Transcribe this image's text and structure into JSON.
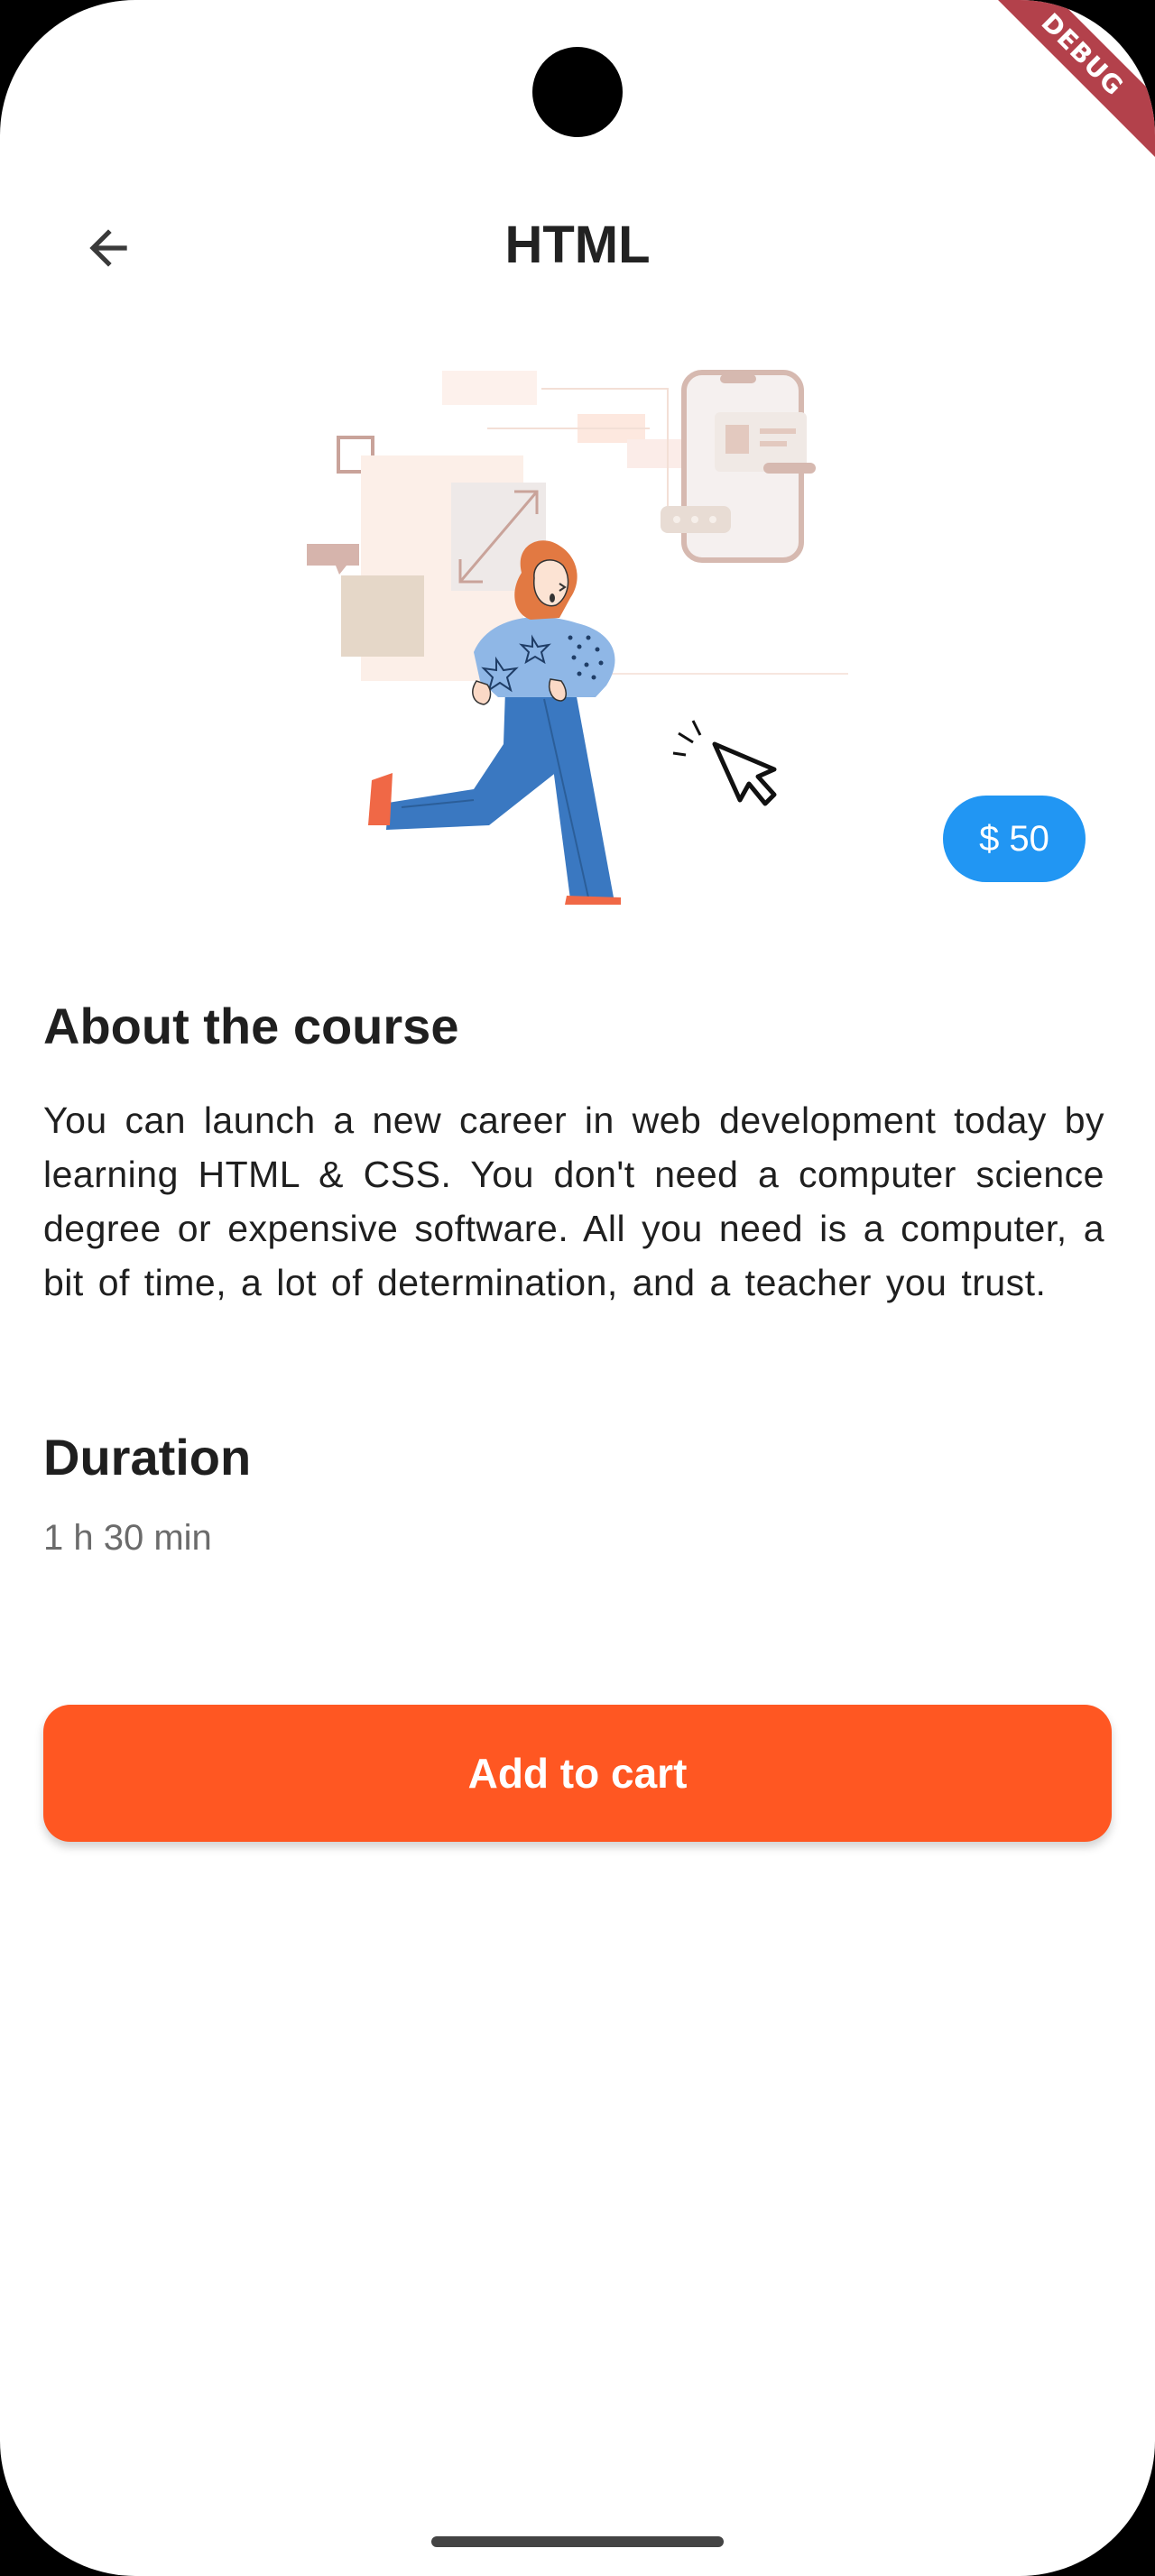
{
  "appbar": {
    "title": "HTML",
    "back_icon": "arrow-left-icon"
  },
  "debug_banner": "DEBUG",
  "course": {
    "price": "$ 50",
    "about_heading": "About the course",
    "about_text": "You can launch a new career in web development today by learning HTML & CSS. You don't need a computer science degree or expensive software. All you need is a computer, a bit of time, a lot of determination, and a teacher you trust.",
    "duration_heading": "Duration",
    "duration_value": "1 h 30 min"
  },
  "actions": {
    "add_to_cart_label": "Add to cart"
  },
  "colors": {
    "accent": "#ff5722",
    "price_badge": "#2196f3",
    "debug_ribbon": "#b3414b"
  }
}
